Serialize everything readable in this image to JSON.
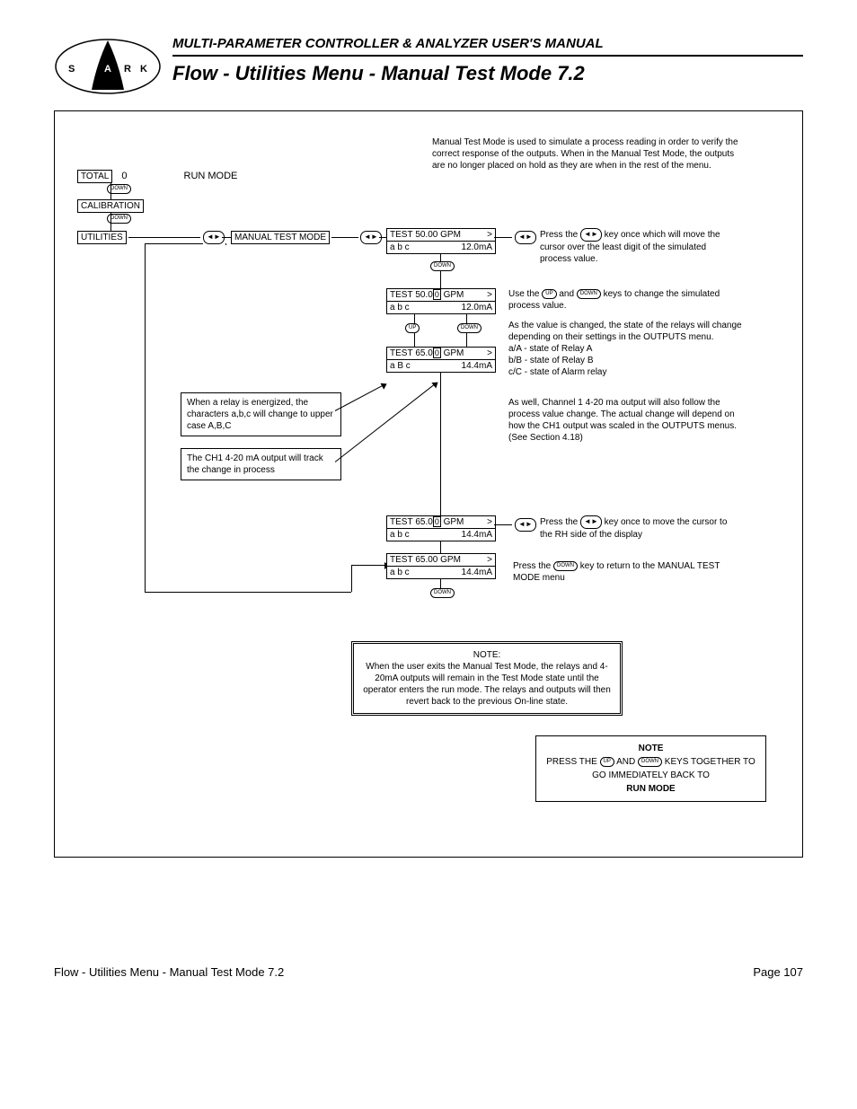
{
  "header": {
    "manual_title": "MULTI-PARAMETER CONTROLLER & ANALYZER USER'S MANUAL",
    "section_title": "Flow - Utilities Menu - Manual Test Mode 7.2",
    "logo_letters": "S H A R K"
  },
  "menu": {
    "total_label": "TOTAL",
    "total_value": "0",
    "run_mode": "RUN MODE",
    "calibration": "CALIBRATION",
    "utilities": "UTILITIES",
    "manual_test_mode": "MANUAL TEST MODE"
  },
  "displays": {
    "d1": {
      "l1a": "TEST",
      "l1b": "50.00",
      "l1c": "GPM",
      "tail": ">",
      "r2a": "a  b  c",
      "r2b": "12.0mA"
    },
    "d2": {
      "l1a": "TEST",
      "l1b": "50.0",
      "hl": "0",
      "l1c": "GPM",
      "tail": ">",
      "r2a": "a  b  c",
      "r2b": "12.0mA"
    },
    "d3": {
      "l1a": "TEST",
      "l1b": "65.0",
      "hl": "0",
      "l1c": "GPM",
      "tail": ">",
      "r2a": "a  B  c",
      "r2b": "14.4mA"
    },
    "d4": {
      "l1a": "TEST",
      "l1b": "65.0",
      "hl": "0",
      "l1c": "GPM",
      "tail": ">",
      "r2a": "a  b  c",
      "r2b": "14.4mA"
    },
    "d5": {
      "l1a": "TEST",
      "l1b": "65.00",
      "l1c": "GPM",
      "tail": ">",
      "r2a": "a  b  c",
      "r2b": "14.4mA"
    }
  },
  "keys": {
    "down": "DOWN",
    "up": "UP"
  },
  "text": {
    "intro": "Manual Test Mode is used to simulate a process reading in order to verify the correct response of the outputs. When in the Manual Test Mode, the outputs are no longer placed on hold as they are when in the rest of the menu.",
    "press_lr1a": "Press the ",
    "press_lr1b": " key once which will move the cursor over the least digit of the simulated process value.",
    "use_keys_a": "Use the ",
    "use_keys_b": " and ",
    "use_keys_c": " keys to change the simulated process value.",
    "change_state": "As the value is changed, the state of the relays will change depending on their settings in the OUTPUTS menu.",
    "relayA": "a/A - state of Relay A",
    "relayB": "b/B - state of Relay B",
    "relayC": "c/C - state of Alarm relay",
    "ch1_follow": "As well, Channel 1 4-20 ma output will also follow the process value change. The actual change will depend on how the CH1 output was scaled in the OUTPUTS menus.",
    "see_section": "(See Section 4.18)",
    "relay_energized": "When a relay is energized, the characters a,b,c will change to upper case A,B,C",
    "ch1_track": "The CH1 4-20 mA output will track the change in process",
    "press_lr2a": "Press the ",
    "press_lr2b": " key once to move the cursor  to the RH side of the display",
    "press_down_a": "Press the ",
    "press_down_b": " key to return to the MANUAL TEST MODE menu",
    "exit_note_title": "NOTE:",
    "exit_note": "When the user exits the Manual Test Mode, the relays and 4-20mA outputs will remain in the Test Mode state until the operator enters the run mode. The relays and outputs will then revert back to the previous On-line state.",
    "bottom_note_title": "NOTE",
    "bottom_note_a": "PRESS THE ",
    "bottom_note_b": " AND ",
    "bottom_note_c": " KEYS TOGETHER TO GO IMMEDIATELY BACK TO",
    "bottom_note_d": "RUN MODE"
  },
  "footer": {
    "left": "Flow - Utilities Menu - Manual Test Mode 7.2",
    "right": "Page 107"
  }
}
